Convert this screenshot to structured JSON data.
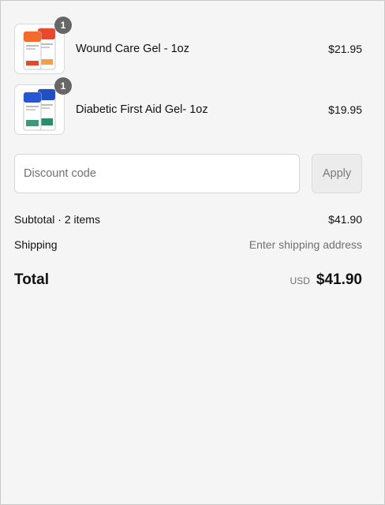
{
  "items": [
    {
      "name": "Wound Care Gel - 1oz",
      "price": "$21.95",
      "quantity": "1",
      "icon": "product-tube-image",
      "accent": "#e8492a"
    },
    {
      "name": "Diabetic First Aid Gel- 1oz",
      "price": "$19.95",
      "quantity": "1",
      "icon": "product-tube-image",
      "accent": "#1f4fc2"
    }
  ],
  "discount": {
    "placeholder": "Discount code",
    "value": "",
    "apply_label": "Apply"
  },
  "summary": {
    "subtotal_label": "Subtotal · 2 items",
    "subtotal_value": "$41.90",
    "shipping_label": "Shipping",
    "shipping_value": "Enter shipping address",
    "total_label": "Total",
    "currency": "USD",
    "total_value": "$41.90"
  }
}
